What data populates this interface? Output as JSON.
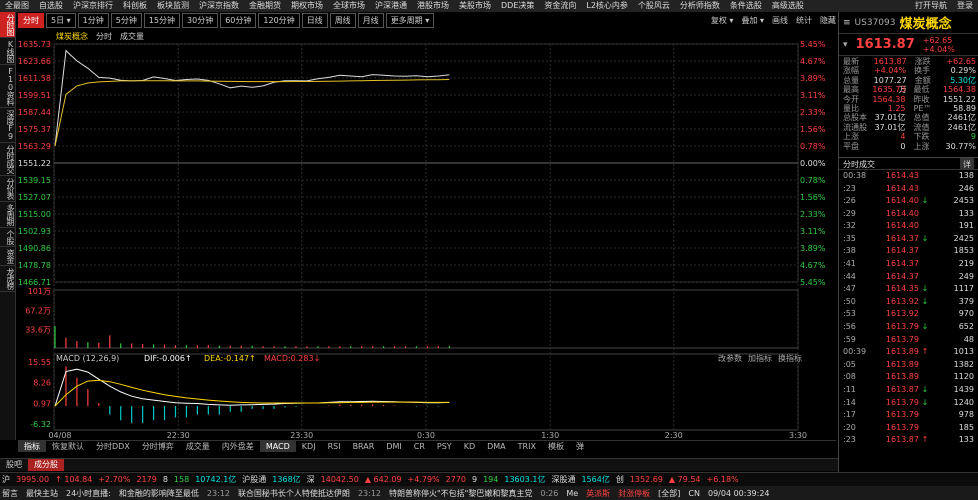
{
  "menubar": {
    "left": [
      "全最图",
      "自选股",
      "沪深京排行",
      "科创板",
      "板块监测",
      "沪深京指数",
      "金融期货",
      "期权市场",
      "全球市场",
      "沪深港通",
      "港股市场",
      "美股市场",
      "DDE决策",
      "资金流向",
      "L2核心内参",
      "个股风云",
      "分析师指数",
      "条件选股",
      "高级选股"
    ],
    "right": [
      "打开导航",
      "登录"
    ]
  },
  "left_tabs": [
    {
      "label": "分时图",
      "active": true
    },
    {
      "label": "K线图",
      "active": false
    },
    {
      "label": "F10资料",
      "active": false
    },
    {
      "label": "深度F9",
      "active": false
    },
    {
      "label": "分时成交",
      "active": false
    },
    {
      "label": "分价表",
      "active": false
    },
    {
      "label": "多周期",
      "active": false
    },
    {
      "label": "个股",
      "active": false
    },
    {
      "label": "资金",
      "active": false
    },
    {
      "label": "龙虎榜",
      "active": false
    }
  ],
  "toolbar": [
    {
      "label": "分时",
      "active": true
    },
    {
      "label": "5日 ▾",
      "active": false
    },
    {
      "label": "1分钟",
      "active": false
    },
    {
      "label": "5分钟",
      "active": false
    },
    {
      "label": "15分钟",
      "active": false
    },
    {
      "label": "30分钟",
      "active": false
    },
    {
      "label": "60分钟",
      "active": false
    },
    {
      "label": "120分钟",
      "active": false
    },
    {
      "label": "日线",
      "active": false
    },
    {
      "label": "周线",
      "active": false
    },
    {
      "label": "月线",
      "active": false
    },
    {
      "label": "更多周期 ▾",
      "active": false
    }
  ],
  "right_tools": [
    "复权 ▾",
    "叠加 ▾",
    "画线",
    "统计",
    "隐藏"
  ],
  "chart_header": {
    "name": "煤炭概念",
    "items": [
      "分时",
      "成交量"
    ]
  },
  "chart_data": {
    "type": "line",
    "series": [
      {
        "name": "分时",
        "values": [
          1563.3,
          1631.0,
          1623.7,
          1618.5,
          1612.0,
          1611.5,
          1610.0,
          1609.5,
          1609.8,
          1612.4,
          1611.2,
          1609.8,
          1610.5,
          1610.9,
          1609.9,
          1607.5,
          1604.6,
          1605.8,
          1605.0,
          1606.0,
          1608.5,
          1609.7,
          1609.6,
          1609.5,
          1611.0,
          1612.0,
          1613.5,
          1613.0,
          1612.5,
          1614.0,
          1613.6,
          1613.0,
          1612.8,
          1613.2,
          1612.5,
          1613.0,
          1613.9
        ]
      },
      {
        "name": "均价",
        "values": [
          1563.3,
          1600.0,
          1606.0,
          1608.0,
          1608.8,
          1609.2,
          1609.5,
          1609.6,
          1609.6,
          1609.6,
          1609.6,
          1609.5,
          1609.5,
          1609.5,
          1609.4,
          1609.3,
          1609.2,
          1609.1,
          1609.0,
          1609.0,
          1609.0,
          1609.0,
          1609.1,
          1609.1,
          1609.2,
          1609.3,
          1609.4,
          1609.5,
          1609.6,
          1609.8,
          1609.9,
          1610.0,
          1610.1,
          1610.2,
          1610.3,
          1610.4,
          1610.5
        ]
      }
    ],
    "prev_close": 1551.22,
    "price_ticks": [
      "1635.73",
      "1623.66",
      "1611.58",
      "1599.51",
      "1587.44",
      "1575.37",
      "1563.29",
      "1551.22",
      "1539.15",
      "1527.07",
      "1515.00",
      "1502.93",
      "1490.86",
      "1478.78",
      "1466.71"
    ],
    "pct_ticks": [
      "5.45%",
      "4.67%",
      "3.89%",
      "3.11%",
      "2.33%",
      "1.56%",
      "0.78%",
      "0.00%",
      "0.78%",
      "1.56%",
      "2.33%",
      "3.11%",
      "3.89%",
      "4.67%",
      "5.45%"
    ],
    "time_ticks": [
      "04/08",
      "22:30",
      "23:30",
      "0:30",
      "1:30",
      "2:30",
      "3:30"
    ],
    "volume": {
      "ticks": [
        "101万",
        "67.2万",
        "33.6万"
      ],
      "values": [
        38,
        18,
        12,
        10,
        9,
        22,
        8,
        8,
        7,
        6,
        6,
        5,
        5,
        5,
        5,
        4,
        4,
        4,
        4,
        3,
        3,
        3,
        3,
        3,
        3,
        3,
        3,
        3,
        3,
        3,
        3,
        3,
        3,
        3,
        3,
        3,
        3
      ]
    },
    "macd": {
      "label": "MACD (12,26,9)",
      "dif": "DIF:-0.006↑",
      "dea": "DEA:-0.147↑",
      "macd": "MACD:0.283↓",
      "ticks": [
        "15.55",
        "8.26",
        "0.97",
        "-6.32"
      ],
      "buttons": [
        "改参数",
        "加指标",
        "换指标"
      ],
      "dif_values": [
        0,
        12.2,
        13.0,
        12.0,
        9.5,
        7.0,
        5.0,
        3.5,
        2.6,
        2.1,
        1.6,
        1.2,
        1.0,
        0.9,
        0.6,
        0.4,
        0.3,
        0.4,
        0.5,
        0.6,
        0.7,
        0.9,
        1.0,
        1.1,
        1.1,
        1.3,
        1.5,
        1.5,
        1.6,
        1.7,
        1.6,
        1.5,
        1.4,
        1.3,
        1.2,
        1.2,
        1.3
      ],
      "dea_values": [
        0,
        4.0,
        7.0,
        8.8,
        9.1,
        8.6,
        7.7,
        6.6,
        5.6,
        4.8,
        4.0,
        3.4,
        2.9,
        2.5,
        2.1,
        1.8,
        1.5,
        1.3,
        1.2,
        1.1,
        1.1,
        1.1,
        1.1,
        1.1,
        1.1,
        1.2,
        1.2,
        1.3,
        1.3,
        1.4,
        1.4,
        1.4,
        1.4,
        1.4,
        1.3,
        1.3,
        1.3
      ],
      "hist_values": [
        0,
        14,
        10,
        6,
        1,
        -3,
        -5,
        -6,
        -6,
        -5,
        -5,
        -4,
        -4,
        -3,
        -3,
        -3,
        -2,
        -2,
        -1,
        -1,
        -1,
        -0.5,
        -0.3,
        0,
        0,
        0.2,
        0.5,
        0.4,
        0.5,
        0.6,
        0.4,
        0.2,
        0,
        -0.2,
        -0.2,
        -0.2,
        0
      ]
    }
  },
  "sub_tabs": [
    {
      "label": "指标",
      "active": true
    },
    {
      "label": "恢复默认",
      "active": false
    },
    {
      "label": "分时DDX",
      "active": false
    },
    {
      "label": "分时博弈",
      "active": false
    },
    {
      "label": "成交量",
      "active": false
    },
    {
      "label": "内外盘差",
      "active": false
    },
    {
      "label": "MACD",
      "active": true
    },
    {
      "label": "KDJ",
      "active": false
    },
    {
      "label": "RSI",
      "active": false
    },
    {
      "label": "BRAR",
      "active": false
    },
    {
      "label": "DMI",
      "active": false
    },
    {
      "label": "CR",
      "active": false
    },
    {
      "label": "PSY",
      "active": false
    },
    {
      "label": "KD",
      "active": false
    },
    {
      "label": "DMA",
      "active": false
    },
    {
      "label": "TRIX",
      "active": false
    },
    {
      "label": "模板",
      "active": false
    },
    {
      "label": "弹",
      "active": false
    }
  ],
  "bottom_tabs": [
    {
      "label": "股吧",
      "active": false
    },
    {
      "label": "成分股",
      "active": true
    }
  ],
  "right_panel": {
    "code": "US37093",
    "name": "煤炭概念",
    "price": "1613.87",
    "change": "+62.65",
    "change_pct": "+4.04%",
    "quote_rows": [
      [
        {
          "l": "最新",
          "v": "1613.87",
          "c": "red"
        },
        {
          "l": "涨跌",
          "v": "+62.65",
          "c": "red"
        }
      ],
      [
        {
          "l": "涨幅",
          "v": "+4.04%",
          "c": "red"
        },
        {
          "l": "换手",
          "v": "0.29%",
          "c": "wht"
        }
      ],
      [
        {
          "l": "总量",
          "v": "1077.27万",
          "c": "wht"
        },
        {
          "l": "金额",
          "v": "5.30亿",
          "c": "cyan"
        }
      ],
      [
        {
          "l": "最高",
          "v": "1635.73",
          "c": "red"
        },
        {
          "l": "最低",
          "v": "1564.38",
          "c": "red"
        }
      ],
      [
        {
          "l": "今开",
          "v": "1564.38",
          "c": "red"
        },
        {
          "l": "昨收",
          "v": "1551.22",
          "c": "wht"
        }
      ],
      [
        {
          "l": "量比",
          "v": "1.25",
          "c": "red"
        },
        {
          "l": "PE™",
          "v": "58.89",
          "c": "wht"
        }
      ],
      [
        {
          "l": "总股本",
          "v": "37.01亿",
          "c": "wht"
        },
        {
          "l": "总值",
          "v": "2461亿",
          "c": "wht"
        }
      ],
      [
        {
          "l": "流通股",
          "v": "37.01亿",
          "c": "wht"
        },
        {
          "l": "流值",
          "v": "2461亿",
          "c": "wht"
        }
      ],
      [
        {
          "l": "上涨",
          "v": "4",
          "c": "red"
        },
        {
          "l": "下跌",
          "v": "9",
          "c": "grn"
        }
      ],
      [
        {
          "l": "平盘",
          "v": "0",
          "c": "wht"
        },
        {
          "l": "上涨",
          "v": "30.77%",
          "c": "wht"
        }
      ]
    ],
    "trades_title": "分时成交",
    "trades_btn": "详",
    "trades": [
      {
        "t": "00:38",
        "p": "1614.43",
        "a": "",
        "c": "",
        "v": "138"
      },
      {
        "t": ":23",
        "p": "1614.43",
        "a": "",
        "c": "",
        "v": "246"
      },
      {
        "t": ":26",
        "p": "1614.40",
        "a": "↓",
        "c": "grn",
        "v": "2453"
      },
      {
        "t": ":29",
        "p": "1614.40",
        "a": "",
        "c": "",
        "v": "133"
      },
      {
        "t": ":32",
        "p": "1614.40",
        "a": "",
        "c": "",
        "v": "191"
      },
      {
        "t": ":35",
        "p": "1614.37",
        "a": "↓",
        "c": "grn",
        "v": "2425"
      },
      {
        "t": ":38",
        "p": "1614.37",
        "a": "",
        "c": "",
        "v": "1853"
      },
      {
        "t": ":41",
        "p": "1614.37",
        "a": "",
        "c": "",
        "v": "219"
      },
      {
        "t": ":44",
        "p": "1614.37",
        "a": "",
        "c": "",
        "v": "249"
      },
      {
        "t": ":47",
        "p": "1614.35",
        "a": "↓",
        "c": "grn",
        "v": "1117"
      },
      {
        "t": ":50",
        "p": "1613.92",
        "a": "↓",
        "c": "grn",
        "v": "379"
      },
      {
        "t": ":53",
        "p": "1613.92",
        "a": "",
        "c": "",
        "v": "970"
      },
      {
        "t": ":56",
        "p": "1613.79",
        "a": "↓",
        "c": "grn",
        "v": "652"
      },
      {
        "t": ":59",
        "p": "1613.79",
        "a": "",
        "c": "",
        "v": "48"
      },
      {
        "t": "00:39",
        "p": "1613.89",
        "a": "↑",
        "c": "red",
        "v": "1013"
      },
      {
        "t": ":05",
        "p": "1613.89",
        "a": "",
        "c": "",
        "v": "1382"
      },
      {
        "t": ":08",
        "p": "1613.89",
        "a": "",
        "c": "",
        "v": "1120"
      },
      {
        "t": ":11",
        "p": "1613.87",
        "a": "↓",
        "c": "grn",
        "v": "1439"
      },
      {
        "t": ":14",
        "p": "1613.79",
        "a": "↓",
        "c": "grn",
        "v": "1240"
      },
      {
        "t": ":17",
        "p": "1613.79",
        "a": "",
        "c": "",
        "v": "978"
      },
      {
        "t": ":20",
        "p": "1613.79",
        "a": "",
        "c": "",
        "v": "185"
      },
      {
        "t": ":23",
        "p": "1613.87",
        "a": "↑",
        "c": "red",
        "v": "133"
      }
    ]
  },
  "index_bar": [
    {
      "t": "沪",
      "c": "wht"
    },
    {
      "t": "3995.00",
      "c": "red"
    },
    {
      "t": "↑ 104.84",
      "c": "red"
    },
    {
      "t": "+2.70%",
      "c": "red"
    },
    {
      "t": "2179",
      "c": "red"
    },
    {
      "t": "8",
      "c": "wht"
    },
    {
      "t": "158",
      "c": "grn"
    },
    {
      "t": "10742.1亿",
      "c": "cyan"
    },
    {
      "t": "沪股通",
      "c": "wht"
    },
    {
      "t": "1368亿",
      "c": "cyan"
    },
    {
      "t": "深",
      "c": "wht"
    },
    {
      "t": "14042.50",
      "c": "red"
    },
    {
      "t": "▲ 642.09",
      "c": "red"
    },
    {
      "t": "+4.79%",
      "c": "red"
    },
    {
      "t": "2770",
      "c": "red"
    },
    {
      "t": "9",
      "c": "wht"
    },
    {
      "t": "194",
      "c": "grn"
    },
    {
      "t": "13603.1亿",
      "c": "cyan"
    },
    {
      "t": "深股通",
      "c": "wht"
    },
    {
      "t": "1564亿",
      "c": "cyan"
    },
    {
      "t": "创",
      "c": "wht"
    },
    {
      "t": "1352.69",
      "c": "red"
    },
    {
      "t": "▲ 79.54",
      "c": "red"
    },
    {
      "t": "+6.18%",
      "c": "red"
    }
  ],
  "news_bar": [
    {
      "t": "留言",
      "c": "wht"
    },
    {
      "t": "最快主站",
      "c": "wht"
    },
    {
      "t": "24小时直播:",
      "c": "wht"
    },
    {
      "t": "和金融的影响降至最低",
      "c": "wht"
    },
    {
      "t": "23:12",
      "c": "gry"
    },
    {
      "t": "联合国秘书长个人特使抵达伊朗",
      "c": "wht"
    },
    {
      "t": "23:12",
      "c": "gry"
    },
    {
      "t": "特朗普称停火\"不包括\"黎巴嫩和黎真主党",
      "c": "wht"
    },
    {
      "t": "0:26",
      "c": "gry"
    },
    {
      "t": "Me",
      "c": "wht"
    },
    {
      "t": "英派斯",
      "c": "red"
    },
    {
      "t": "封涨停板",
      "c": "red"
    },
    {
      "t": "[全部]",
      "c": "wht"
    },
    {
      "t": "CN",
      "c": "wht"
    },
    {
      "t": "09/04 00:39:24",
      "c": "wht"
    }
  ]
}
